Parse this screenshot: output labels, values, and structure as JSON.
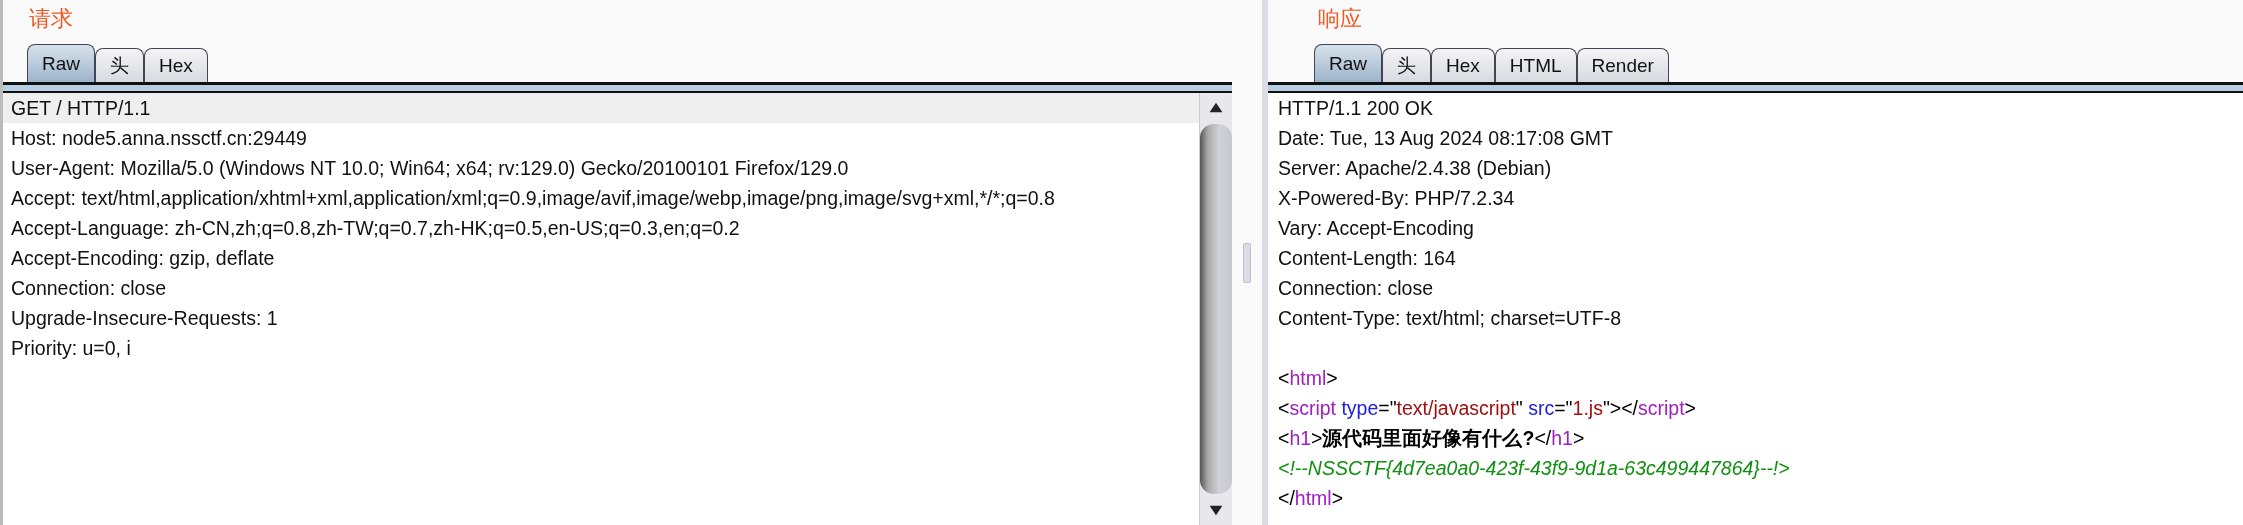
{
  "request": {
    "title": "请求",
    "tabs": [
      {
        "label": "Raw",
        "selected": true
      },
      {
        "label": "头",
        "selected": false
      },
      {
        "label": "Hex",
        "selected": false
      }
    ],
    "lines": [
      {
        "text": "GET / HTTP/1.1",
        "current": true
      },
      {
        "text": "Host: node5.anna.nssctf.cn:29449",
        "current": false
      },
      {
        "text": "User-Agent: Mozilla/5.0 (Windows NT 10.0; Win64; x64; rv:129.0) Gecko/20100101 Firefox/129.0",
        "current": false
      },
      {
        "text": "Accept: text/html,application/xhtml+xml,application/xml;q=0.9,image/avif,image/webp,image/png,image/svg+xml,*/*;q=0.8",
        "current": false
      },
      {
        "text": "Accept-Language: zh-CN,zh;q=0.8,zh-TW;q=0.7,zh-HK;q=0.5,en-US;q=0.3,en;q=0.2",
        "current": false
      },
      {
        "text": "Accept-Encoding: gzip, deflate",
        "current": false
      },
      {
        "text": "Connection: close",
        "current": false
      },
      {
        "text": "Upgrade-Insecure-Requests: 1",
        "current": false
      },
      {
        "text": "Priority: u=0, i",
        "current": false
      }
    ]
  },
  "response": {
    "title": "响应",
    "tabs": [
      {
        "label": "Raw",
        "selected": true
      },
      {
        "label": "头",
        "selected": false
      },
      {
        "label": "Hex",
        "selected": false
      },
      {
        "label": "HTML",
        "selected": false
      },
      {
        "label": "Render",
        "selected": false
      }
    ],
    "header_lines": [
      "HTTP/1.1 200 OK",
      "Date: Tue, 13 Aug 2024 08:17:08 GMT",
      "Server: Apache/2.4.38 (Debian)",
      "X-Powered-By: PHP/7.2.34",
      "Vary: Accept-Encoding",
      "Content-Length: 164",
      "Connection: close",
      "Content-Type: text/html; charset=UTF-8"
    ],
    "body_lines": [
      [
        {
          "kind": "text",
          "text": "<"
        },
        {
          "kind": "tag",
          "text": "html"
        },
        {
          "kind": "text",
          "text": ">"
        }
      ],
      [
        {
          "kind": "text",
          "text": "<"
        },
        {
          "kind": "tag",
          "text": "script"
        },
        {
          "kind": "attr",
          "text": "type"
        },
        {
          "kind": "text",
          "text": "=\""
        },
        {
          "kind": "value",
          "text": "text/javascript"
        },
        {
          "kind": "text",
          "text": "\""
        },
        {
          "kind": "attr",
          "text": "src"
        },
        {
          "kind": "text",
          "text": "=\""
        },
        {
          "kind": "value",
          "text": "1.js"
        },
        {
          "kind": "text",
          "text": "\"></"
        },
        {
          "kind": "tag",
          "text": "script"
        },
        {
          "kind": "text",
          "text": ">"
        }
      ],
      [
        {
          "kind": "text",
          "text": "<"
        },
        {
          "kind": "tag",
          "text": "h1"
        },
        {
          "kind": "text",
          "text": ">"
        },
        {
          "kind": "bold",
          "text": "源代码里面好像有什么?"
        },
        {
          "kind": "text",
          "text": "</"
        },
        {
          "kind": "tag",
          "text": "h1"
        },
        {
          "kind": "text",
          "text": ">"
        }
      ],
      [
        {
          "kind": "comment",
          "text": "<!--NSSCTF{4d7ea0a0-423f-43f9-9d1a-63c499447864}--!>"
        }
      ],
      [
        {
          "kind": "text",
          "text": "</"
        },
        {
          "kind": "tag",
          "text": "html"
        },
        {
          "kind": "text",
          "text": ">"
        }
      ]
    ]
  }
}
